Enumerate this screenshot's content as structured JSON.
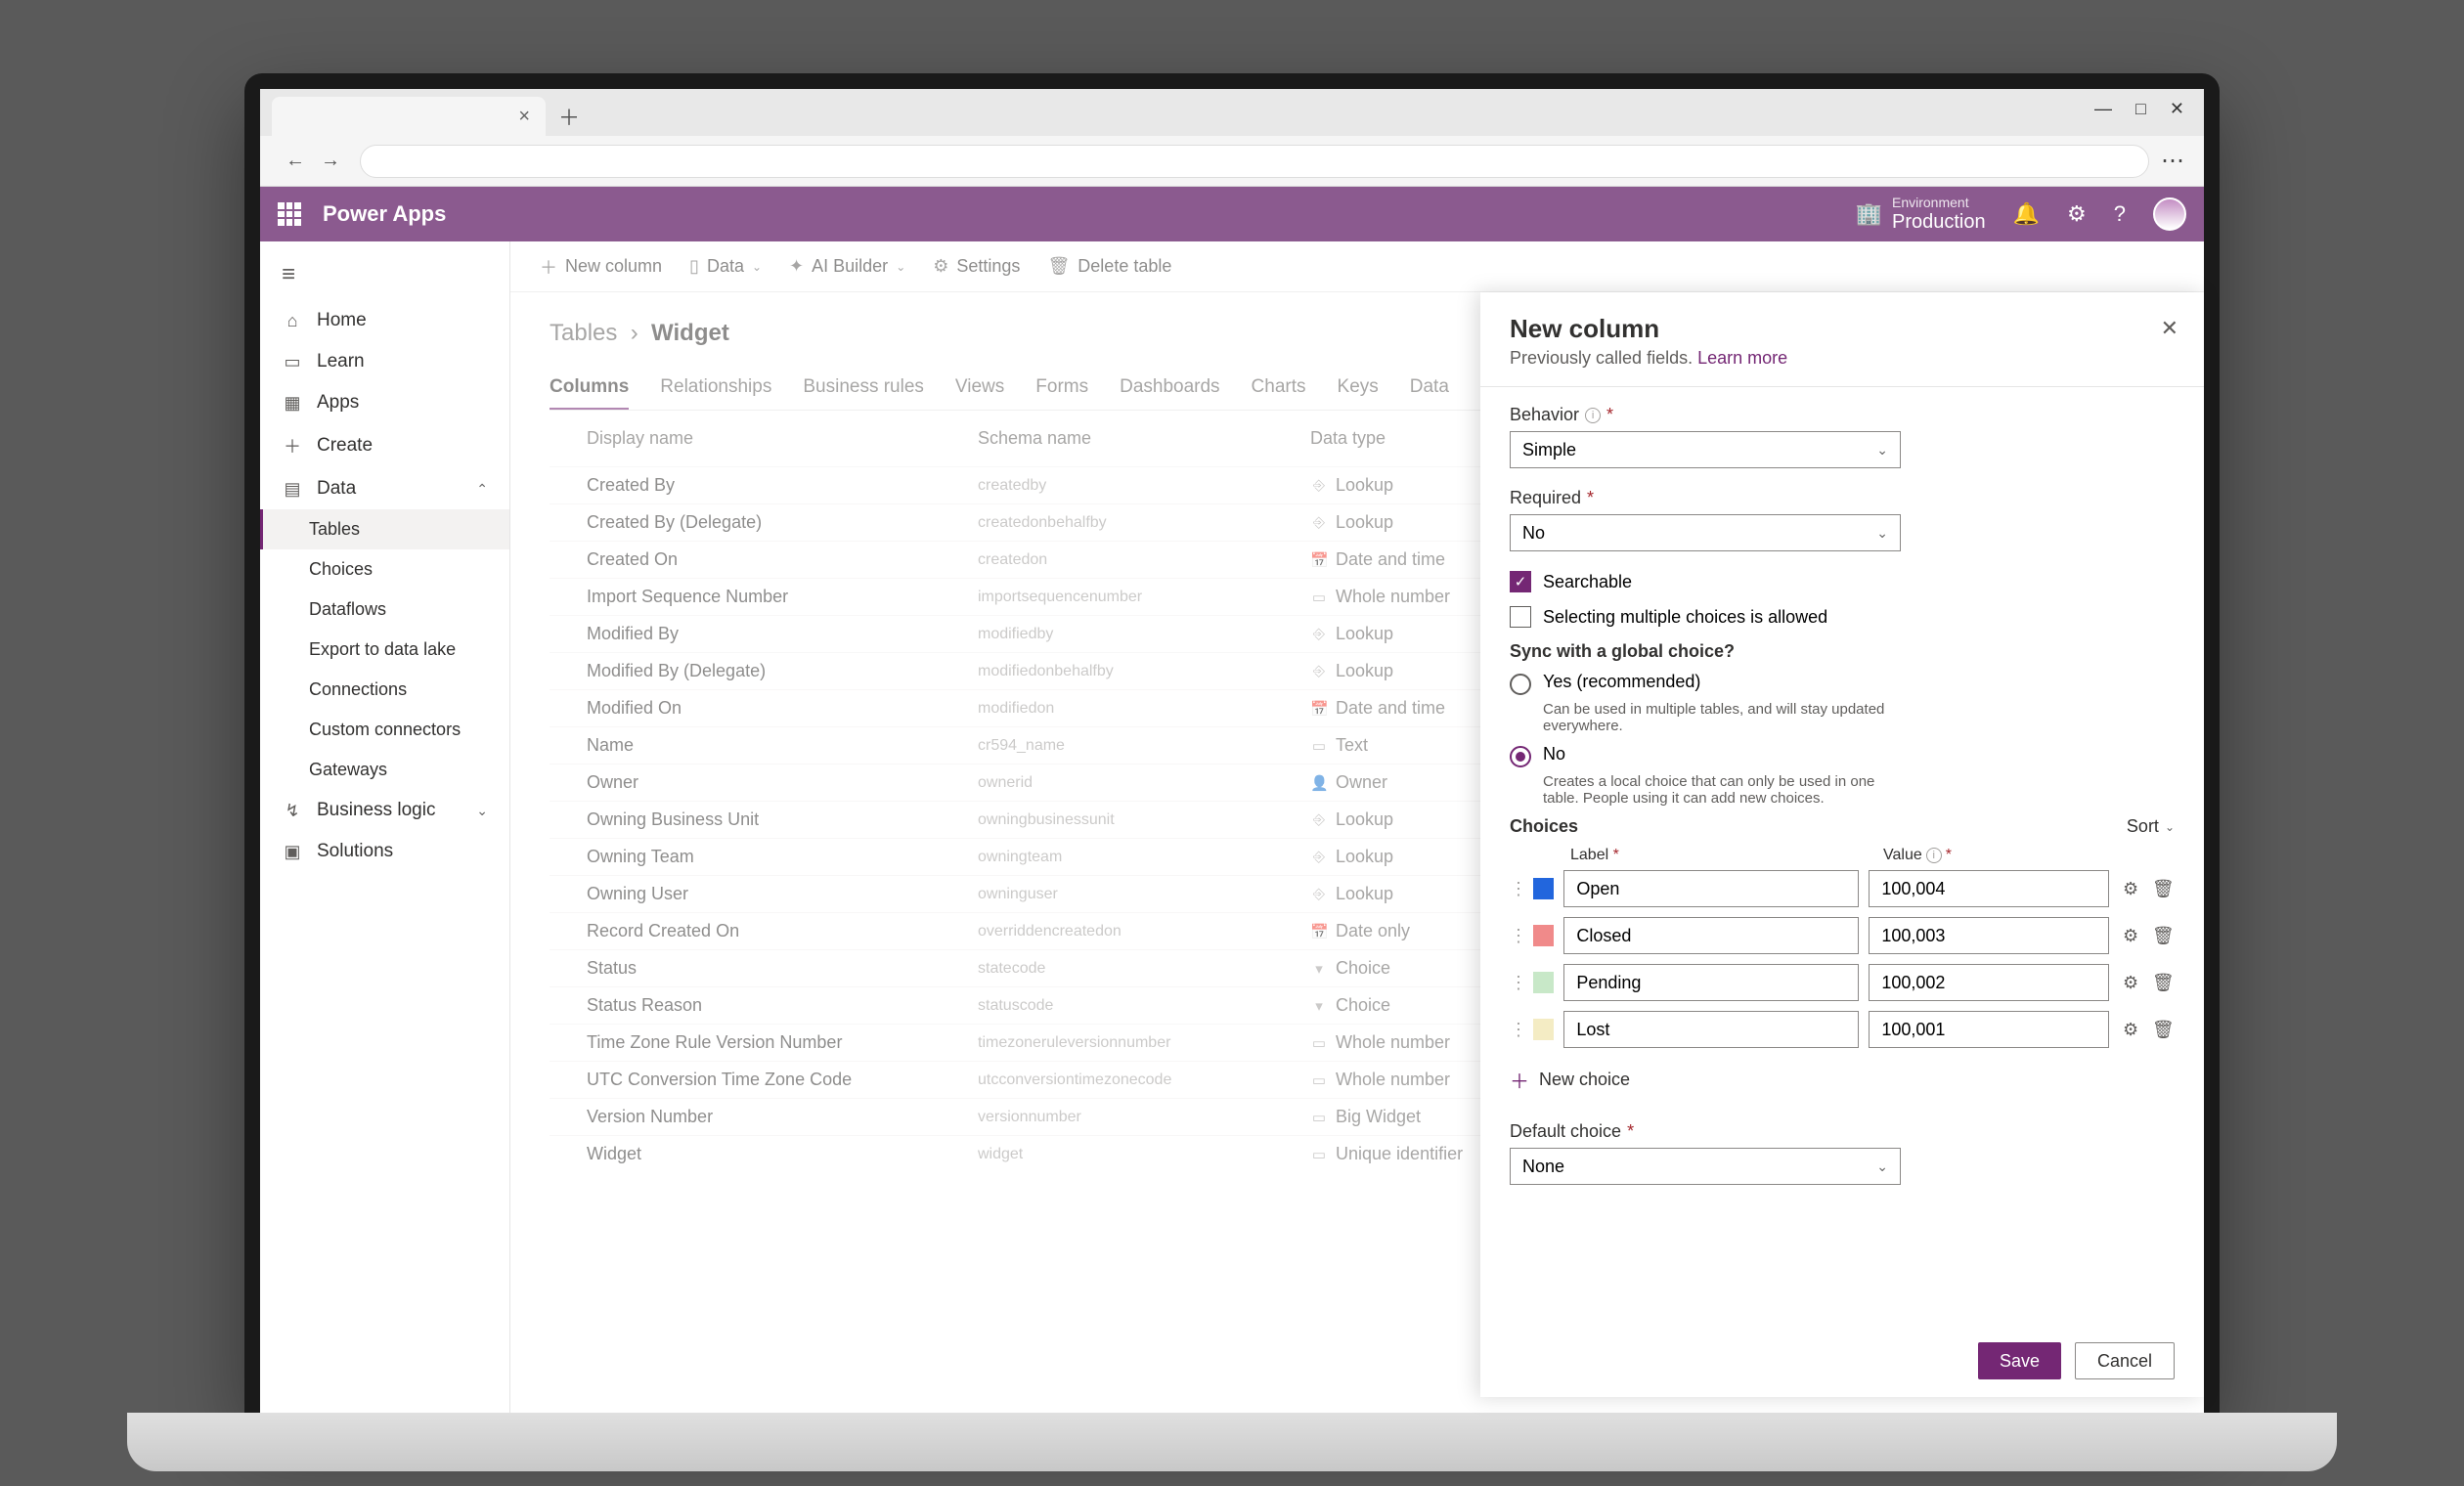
{
  "browser": {
    "tab_close": "×",
    "new_tab": "＋",
    "win_min": "—",
    "win_max": "□",
    "win_close": "✕",
    "back": "←",
    "forward": "→",
    "more": "⋯"
  },
  "header": {
    "app_title": "Power Apps",
    "env_label": "Environment",
    "env_name": "Production"
  },
  "sidebar": {
    "items": [
      {
        "icon": "⌂",
        "label": "Home"
      },
      {
        "icon": "▭",
        "label": "Learn"
      },
      {
        "icon": "▦",
        "label": "Apps"
      },
      {
        "icon": "＋",
        "label": "Create"
      },
      {
        "icon": "▤",
        "label": "Data",
        "expand": true
      }
    ],
    "data_children": [
      "Tables",
      "Choices",
      "Dataflows",
      "Export to data lake",
      "Connections",
      "Custom connectors",
      "Gateways"
    ],
    "footer": [
      {
        "icon": "↯",
        "label": "Business logic",
        "expand": true
      },
      {
        "icon": "▣",
        "label": "Solutions"
      }
    ]
  },
  "toolbar": {
    "new_column": "New column",
    "data": "Data",
    "ai_builder": "AI Builder",
    "settings": "Settings",
    "delete": "Delete table"
  },
  "breadcrumb": {
    "parent": "Tables",
    "current": "Widget"
  },
  "tabs": [
    "Columns",
    "Relationships",
    "Business rules",
    "Views",
    "Forms",
    "Dashboards",
    "Charts",
    "Keys",
    "Data"
  ],
  "columns_header": {
    "display": "Display name",
    "schema": "Schema name",
    "type": "Data type"
  },
  "rows": [
    {
      "d": "Created By",
      "s": "createdby",
      "t": "Lookup",
      "i": "⎆"
    },
    {
      "d": "Created By (Delegate)",
      "s": "createdonbehalfby",
      "t": "Lookup",
      "i": "⎆"
    },
    {
      "d": "Created On",
      "s": "createdon",
      "t": "Date and time",
      "i": "📅"
    },
    {
      "d": "Import Sequence Number",
      "s": "importsequencenumber",
      "t": "Whole number",
      "i": "▭"
    },
    {
      "d": "Modified By",
      "s": "modifiedby",
      "t": "Lookup",
      "i": "⎆"
    },
    {
      "d": "Modified By (Delegate)",
      "s": "modifiedonbehalfby",
      "t": "Lookup",
      "i": "⎆"
    },
    {
      "d": "Modified On",
      "s": "modifiedon",
      "t": "Date and time",
      "i": "📅"
    },
    {
      "d": "Name",
      "s": "cr594_name",
      "t": "Text",
      "i": "▭"
    },
    {
      "d": "Owner",
      "s": "ownerid",
      "t": "Owner",
      "i": "👤"
    },
    {
      "d": "Owning Business Unit",
      "s": "owningbusinessunit",
      "t": "Lookup",
      "i": "⎆"
    },
    {
      "d": "Owning Team",
      "s": "owningteam",
      "t": "Lookup",
      "i": "⎆"
    },
    {
      "d": "Owning User",
      "s": "owninguser",
      "t": "Lookup",
      "i": "⎆"
    },
    {
      "d": "Record Created On",
      "s": "overriddencreatedon",
      "t": "Date only",
      "i": "📅"
    },
    {
      "d": "Status",
      "s": "statecode",
      "t": "Choice",
      "i": "▾"
    },
    {
      "d": "Status Reason",
      "s": "statuscode",
      "t": "Choice",
      "i": "▾"
    },
    {
      "d": "Time Zone Rule Version Number",
      "s": "timezoneruleversionnumber",
      "t": "Whole number",
      "i": "▭"
    },
    {
      "d": "UTC Conversion Time Zone Code",
      "s": "utcconversiontimezonecode",
      "t": "Whole number",
      "i": "▭"
    },
    {
      "d": "Version Number",
      "s": "versionnumber",
      "t": "Big Widget",
      "i": "▭"
    },
    {
      "d": "Widget",
      "s": "widget",
      "t": "Unique identifier",
      "i": "▭"
    }
  ],
  "panel": {
    "title": "New column",
    "subtitle": "Previously called fields.",
    "learn_more": "Learn more",
    "behavior_label": "Behavior",
    "behavior_value": "Simple",
    "required_label": "Required",
    "required_value": "No",
    "searchable": "Searchable",
    "multi": "Selecting multiple choices is allowed",
    "sync_title": "Sync with a global choice?",
    "sync_yes": "Yes (recommended)",
    "sync_yes_desc": "Can be used in multiple tables, and will stay updated everywhere.",
    "sync_no": "No",
    "sync_no_desc": "Creates a local choice that can only be used in one table. People using it can add new choices.",
    "choices_title": "Choices",
    "sort": "Sort",
    "col_label": "Label",
    "col_value": "Value",
    "choices": [
      {
        "color": "#2266dd",
        "label": "Open",
        "value": "100,004"
      },
      {
        "color": "#f08a8a",
        "label": "Closed",
        "value": "100,003"
      },
      {
        "color": "#c8e8c8",
        "label": "Pending",
        "value": "100,002"
      },
      {
        "color": "#f4ecc4",
        "label": "Lost",
        "value": "100,001"
      }
    ],
    "new_choice": "New choice",
    "default_label": "Default choice",
    "default_value": "None",
    "save": "Save",
    "cancel": "Cancel"
  }
}
